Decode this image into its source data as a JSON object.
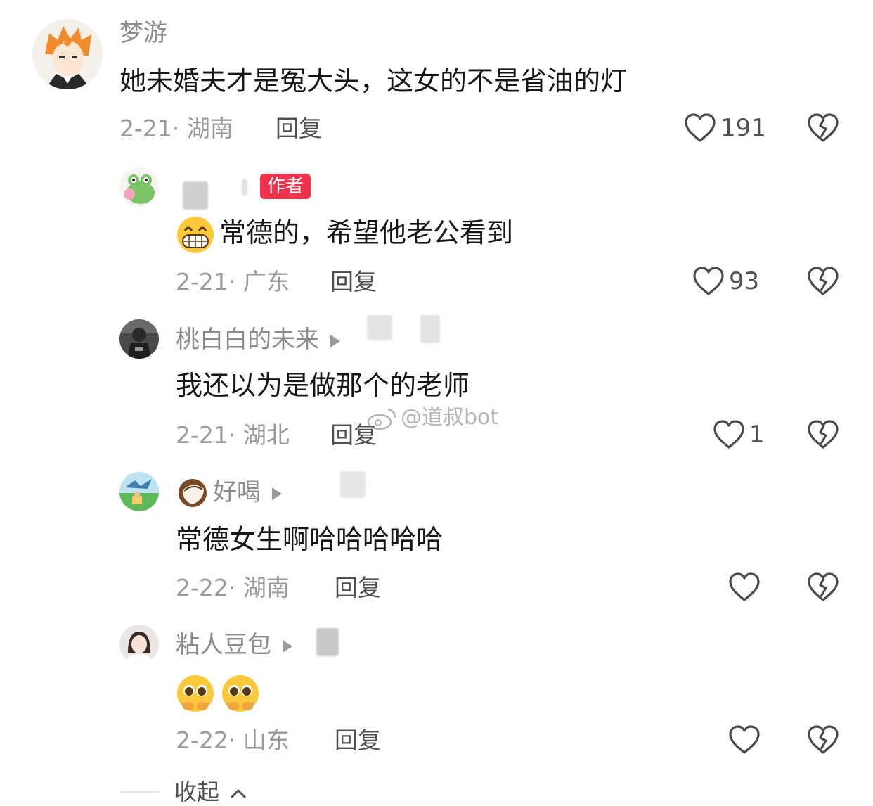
{
  "comments": [
    {
      "user": "梦游",
      "text": "她未婚夫才是冤大头，这女的不是省油的灯",
      "meta": "2-21· 湖南",
      "reply": "回复",
      "likes": "191"
    },
    {
      "user": "",
      "author_badge": "作者",
      "text": "常德的，希望他老公看到",
      "meta": "2-21· 广东",
      "reply": "回复",
      "likes": "93"
    },
    {
      "user": "桃白白的未来",
      "text": "我还以为是做那个的老师",
      "meta": "2-21· 湖北",
      "reply": "回复",
      "likes": "1"
    },
    {
      "user": "好喝",
      "text": "常德女生啊哈哈哈哈哈",
      "meta": "2-22· 湖南",
      "reply": "回复",
      "likes": ""
    },
    {
      "user": "粘人豆包",
      "text": "",
      "meta": "2-22· 山东",
      "reply": "回复",
      "likes": ""
    }
  ],
  "watermark": "@道叔bot",
  "collapse_label": "收起",
  "icons": {
    "like": "heart-outline-icon",
    "dislike": "broken-heart-icon",
    "collapse": "chevron-up-icon",
    "reply_arrow": "play-triangle-icon"
  },
  "colors": {
    "badge": "#f0324c",
    "meta": "#9a9a9a",
    "name": "#8c8c8c"
  }
}
